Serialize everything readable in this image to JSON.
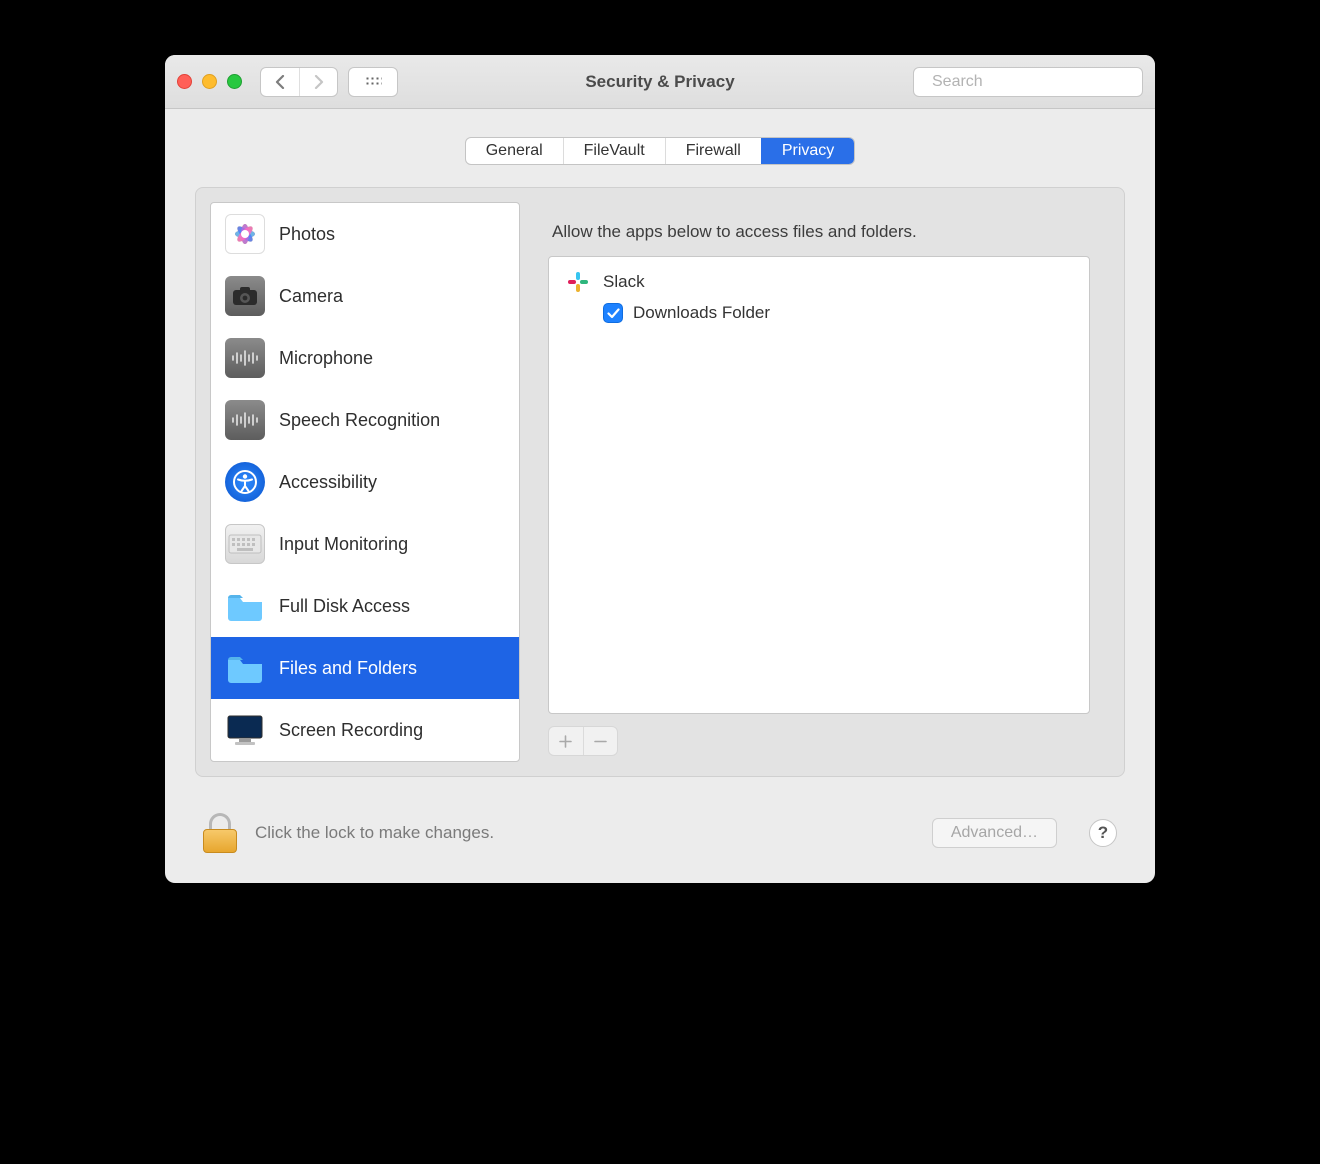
{
  "window": {
    "title": "Security & Privacy",
    "search_placeholder": "Search"
  },
  "tabs": [
    {
      "id": "general",
      "label": "General",
      "active": false
    },
    {
      "id": "filevault",
      "label": "FileVault",
      "active": false
    },
    {
      "id": "firewall",
      "label": "Firewall",
      "active": false
    },
    {
      "id": "privacy",
      "label": "Privacy",
      "active": true
    }
  ],
  "sidebar": {
    "items": [
      {
        "id": "photos",
        "label": "Photos",
        "selected": false
      },
      {
        "id": "camera",
        "label": "Camera",
        "selected": false
      },
      {
        "id": "microphone",
        "label": "Microphone",
        "selected": false
      },
      {
        "id": "speech",
        "label": "Speech Recognition",
        "selected": false
      },
      {
        "id": "accessibility",
        "label": "Accessibility",
        "selected": false
      },
      {
        "id": "input-monitoring",
        "label": "Input Monitoring",
        "selected": false
      },
      {
        "id": "full-disk-access",
        "label": "Full Disk Access",
        "selected": false
      },
      {
        "id": "files-and-folders",
        "label": "Files and Folders",
        "selected": true
      },
      {
        "id": "screen-recording",
        "label": "Screen Recording",
        "selected": false
      }
    ]
  },
  "content": {
    "hint": "Allow the apps below to access files and folders.",
    "apps": [
      {
        "name": "Slack",
        "permissions": [
          {
            "label": "Downloads Folder",
            "checked": true
          }
        ]
      }
    ]
  },
  "footer": {
    "lock_text": "Click the lock to make changes.",
    "advanced_label": "Advanced…",
    "help_label": "?"
  }
}
